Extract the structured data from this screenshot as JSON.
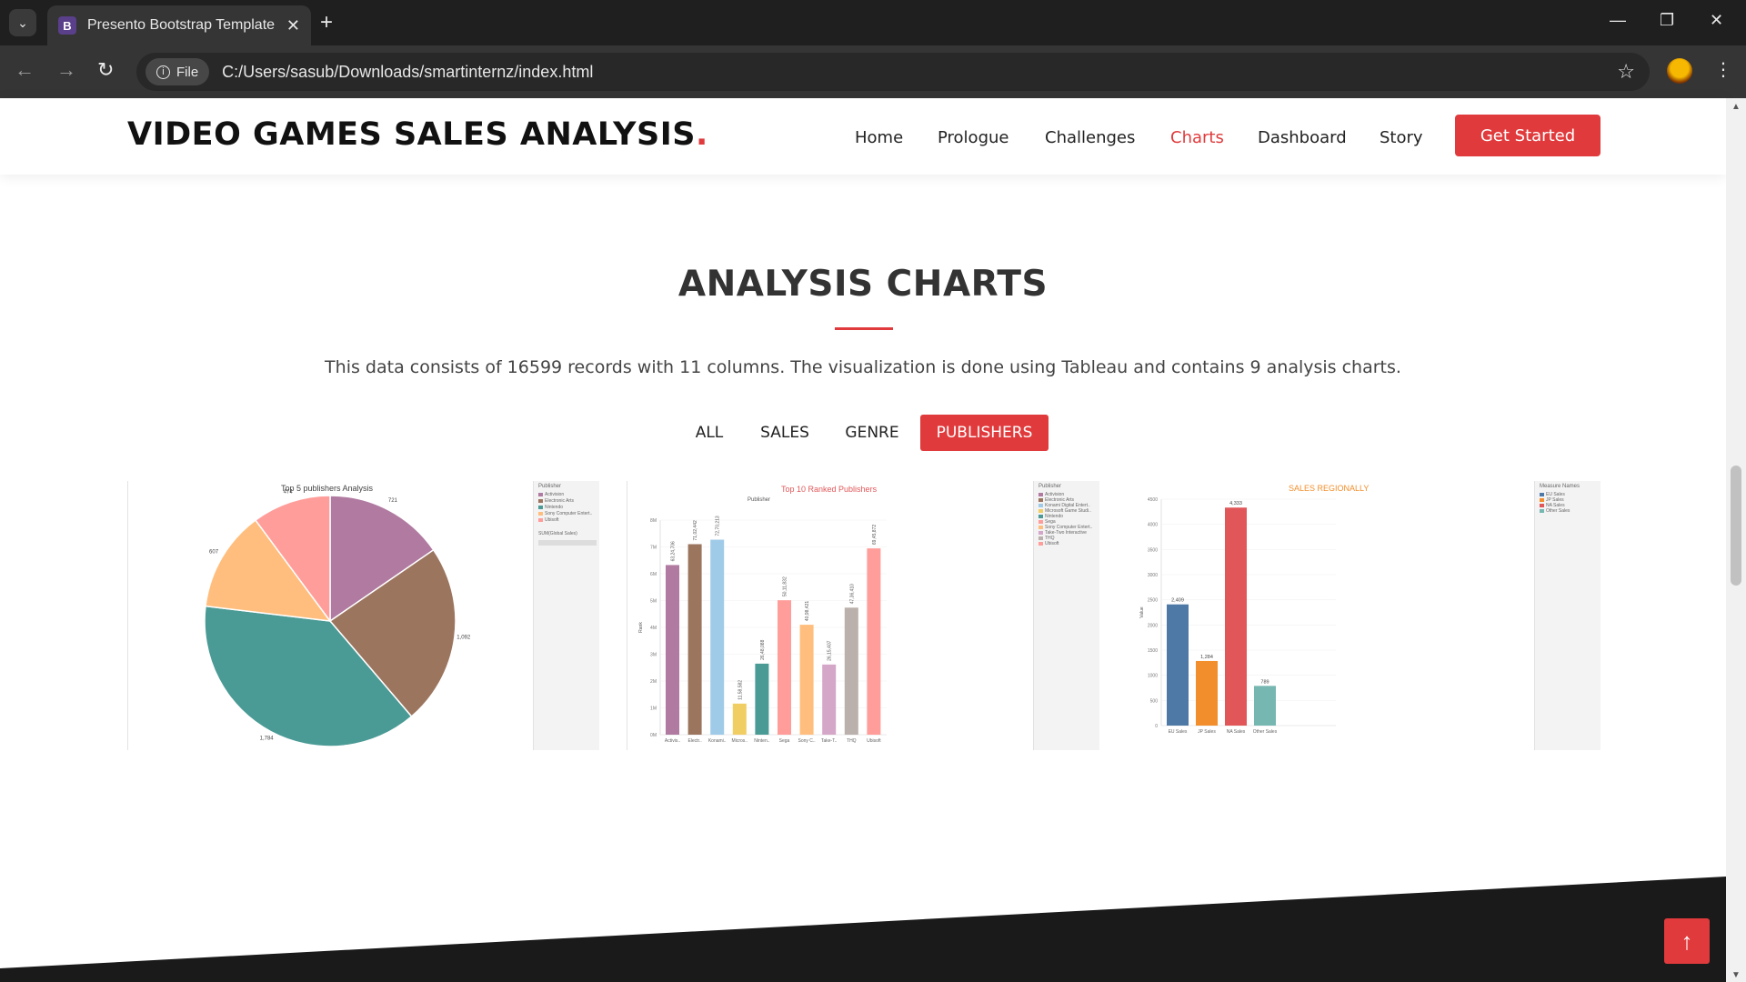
{
  "browser": {
    "tab_title": "Presento Bootstrap Template -",
    "tab_favicon_letter": "B",
    "new_tab_symbol": "+",
    "address_chip": "File",
    "url": "C:/Users/sasub/Downloads/smartinternz/index.html"
  },
  "header": {
    "logo_text": "VIDEO GAMES SALES ANALYSIS",
    "logo_dot": ".",
    "nav": [
      {
        "label": "Home"
      },
      {
        "label": "Prologue"
      },
      {
        "label": "Challenges"
      },
      {
        "label": "Charts",
        "active": true
      },
      {
        "label": "Dashboard"
      },
      {
        "label": "Story"
      }
    ],
    "cta_label": "Get Started"
  },
  "section": {
    "title": "ANALYSIS CHARTS",
    "description": "This data consists of 16599 records with 11 columns. The visualization is done using Tableau and contains 9 analysis charts.",
    "filters": [
      {
        "label": "ALL"
      },
      {
        "label": "SALES"
      },
      {
        "label": "GENRE"
      },
      {
        "label": "PUBLISHERS",
        "active": true
      }
    ]
  },
  "colors": {
    "accent": "#e03a3c",
    "activision": "#b07aa1",
    "electronic_arts": "#9c755f",
    "nintendo": "#4a9a95",
    "sony": "#ffbe7d",
    "ubisoft": "#ff9d9a"
  },
  "legends": {
    "pie": {
      "title": "Publisher",
      "items": [
        "Activision",
        "Electronic Arts",
        "Nintendo",
        "Sony Computer Entert..",
        "Ubisoft"
      ],
      "filter_label": "SUM(Global Sales)"
    },
    "bars": {
      "title": "Publisher",
      "items": [
        "Activision",
        "Electronic Arts",
        "Konami Digital Entert..",
        "Microsoft Game Studi..",
        "Nintendo",
        "Sega",
        "Sony Computer Entert..",
        "Take-Two Interactive",
        "THQ",
        "Ubisoft"
      ]
    },
    "regional": {
      "title": "Measure Names",
      "items": [
        "EU Sales",
        "JP Sales",
        "NA Sales",
        "Other Sales"
      ]
    }
  },
  "chart_data": [
    {
      "type": "pie",
      "title": "Top 5 publishers Analysis",
      "slices": [
        {
          "label": "Activision",
          "value": 721,
          "color": "#b07aa1"
        },
        {
          "label": "Electronic Arts",
          "value": 1092,
          "color": "#9c755f"
        },
        {
          "label": "Nintendo",
          "value": 1784,
          "color": "#4a9a95"
        },
        {
          "label": "Sony Computer Entert..",
          "value": 607,
          "color": "#ffbe7d"
        },
        {
          "label": "Ubisoft",
          "value": 474,
          "color": "#ff9d9a"
        }
      ]
    },
    {
      "type": "bar",
      "title": "Top 10 Ranked Publishers",
      "xlabel": "Publisher",
      "ylabel": "Rank",
      "categories": [
        "Activis..",
        "Electr..",
        "Konami..",
        "Micros..",
        "Ninten..",
        "Sega",
        "Sony C..",
        "Take-T..",
        "THQ",
        "Ubisoft"
      ],
      "values": [
        6324706,
        7102442,
        7270213,
        1158582,
        2648088,
        5011832,
        4098421,
        2615407,
        4736410,
        6945872
      ],
      "value_labels": [
        "63,24,706",
        "71,02,442",
        "72,70,213",
        "11,58,582",
        "26,48,088",
        "50,11,832",
        "40,98,421",
        "26,15,407",
        "47,36,410",
        "69,45,872"
      ],
      "colors": [
        "#b07aa1",
        "#9c755f",
        "#a0cbe8",
        "#f1ce63",
        "#4a9a95",
        "#ff9d9a",
        "#ffbe7d",
        "#d4a6c8",
        "#bab0ac",
        "#ff9d9a"
      ],
      "ylim": [
        0,
        8000000
      ]
    },
    {
      "type": "bar",
      "title": "SALES REGIONALLY",
      "ylabel": "Value",
      "categories": [
        "EU Sales",
        "JP Sales",
        "NA Sales",
        "Other Sales"
      ],
      "values": [
        2409,
        1284,
        4333,
        789
      ],
      "value_labels": [
        "2,409",
        "1,284",
        "4,333",
        "789"
      ],
      "colors": [
        "#4e79a7",
        "#f28e2b",
        "#e15759",
        "#76b7b2"
      ],
      "yticks": [
        0,
        500,
        1000,
        1500,
        2000,
        2500,
        3000,
        3500,
        4000,
        4500
      ],
      "ylim": [
        0,
        4500
      ]
    }
  ]
}
